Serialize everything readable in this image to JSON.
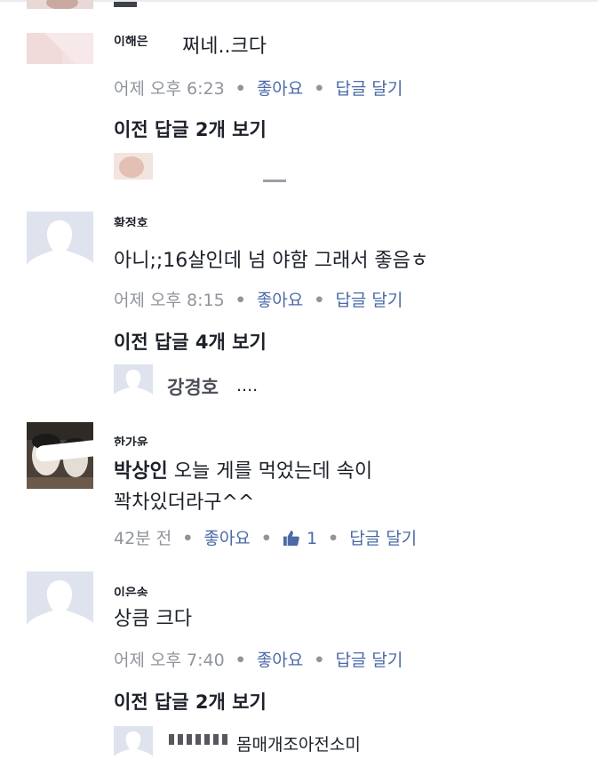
{
  "comments": [
    {
      "name_fragment": "이해은",
      "text": "쩌네..크다",
      "time": "어제 오후 6:23",
      "like": "좋아요",
      "reply": "답글 달기",
      "prev_replies": "이전 답글 2개 보기"
    },
    {
      "name_fragment": "황정호",
      "text": "아니;;16살인데 넘 야함 그래서 좋음ㅎ",
      "time": "어제 오후 8:15",
      "like": "좋아요",
      "reply": "답글 달기",
      "prev_replies": "이전 답글 4개 보기",
      "reply_preview": {
        "name": "강경호",
        "text": "...."
      }
    },
    {
      "name_fragment": "한가윤",
      "tag": "박상인",
      "text_line1": " 오늘 게를 먹었는데 속이",
      "text_line2": "꽉차있더라구^^",
      "time": "42분 전",
      "like": "좋아요",
      "like_count": "1",
      "reply": "답글 달기"
    },
    {
      "name_fragment": "이은송",
      "text": "상큼 크다",
      "time": "어제 오후 7:40",
      "like": "좋아요",
      "reply": "답글 달기",
      "prev_replies": "이전 답글 2개 보기",
      "reply_preview": {
        "text": "몸매개조아전소미"
      }
    }
  ],
  "colors": {
    "link": "#4b6aa7",
    "meta": "#90949c",
    "text": "#1d2129",
    "avatar_placeholder_bg": "#dfe3ee",
    "avatar_placeholder_fg": "#ffffff"
  }
}
